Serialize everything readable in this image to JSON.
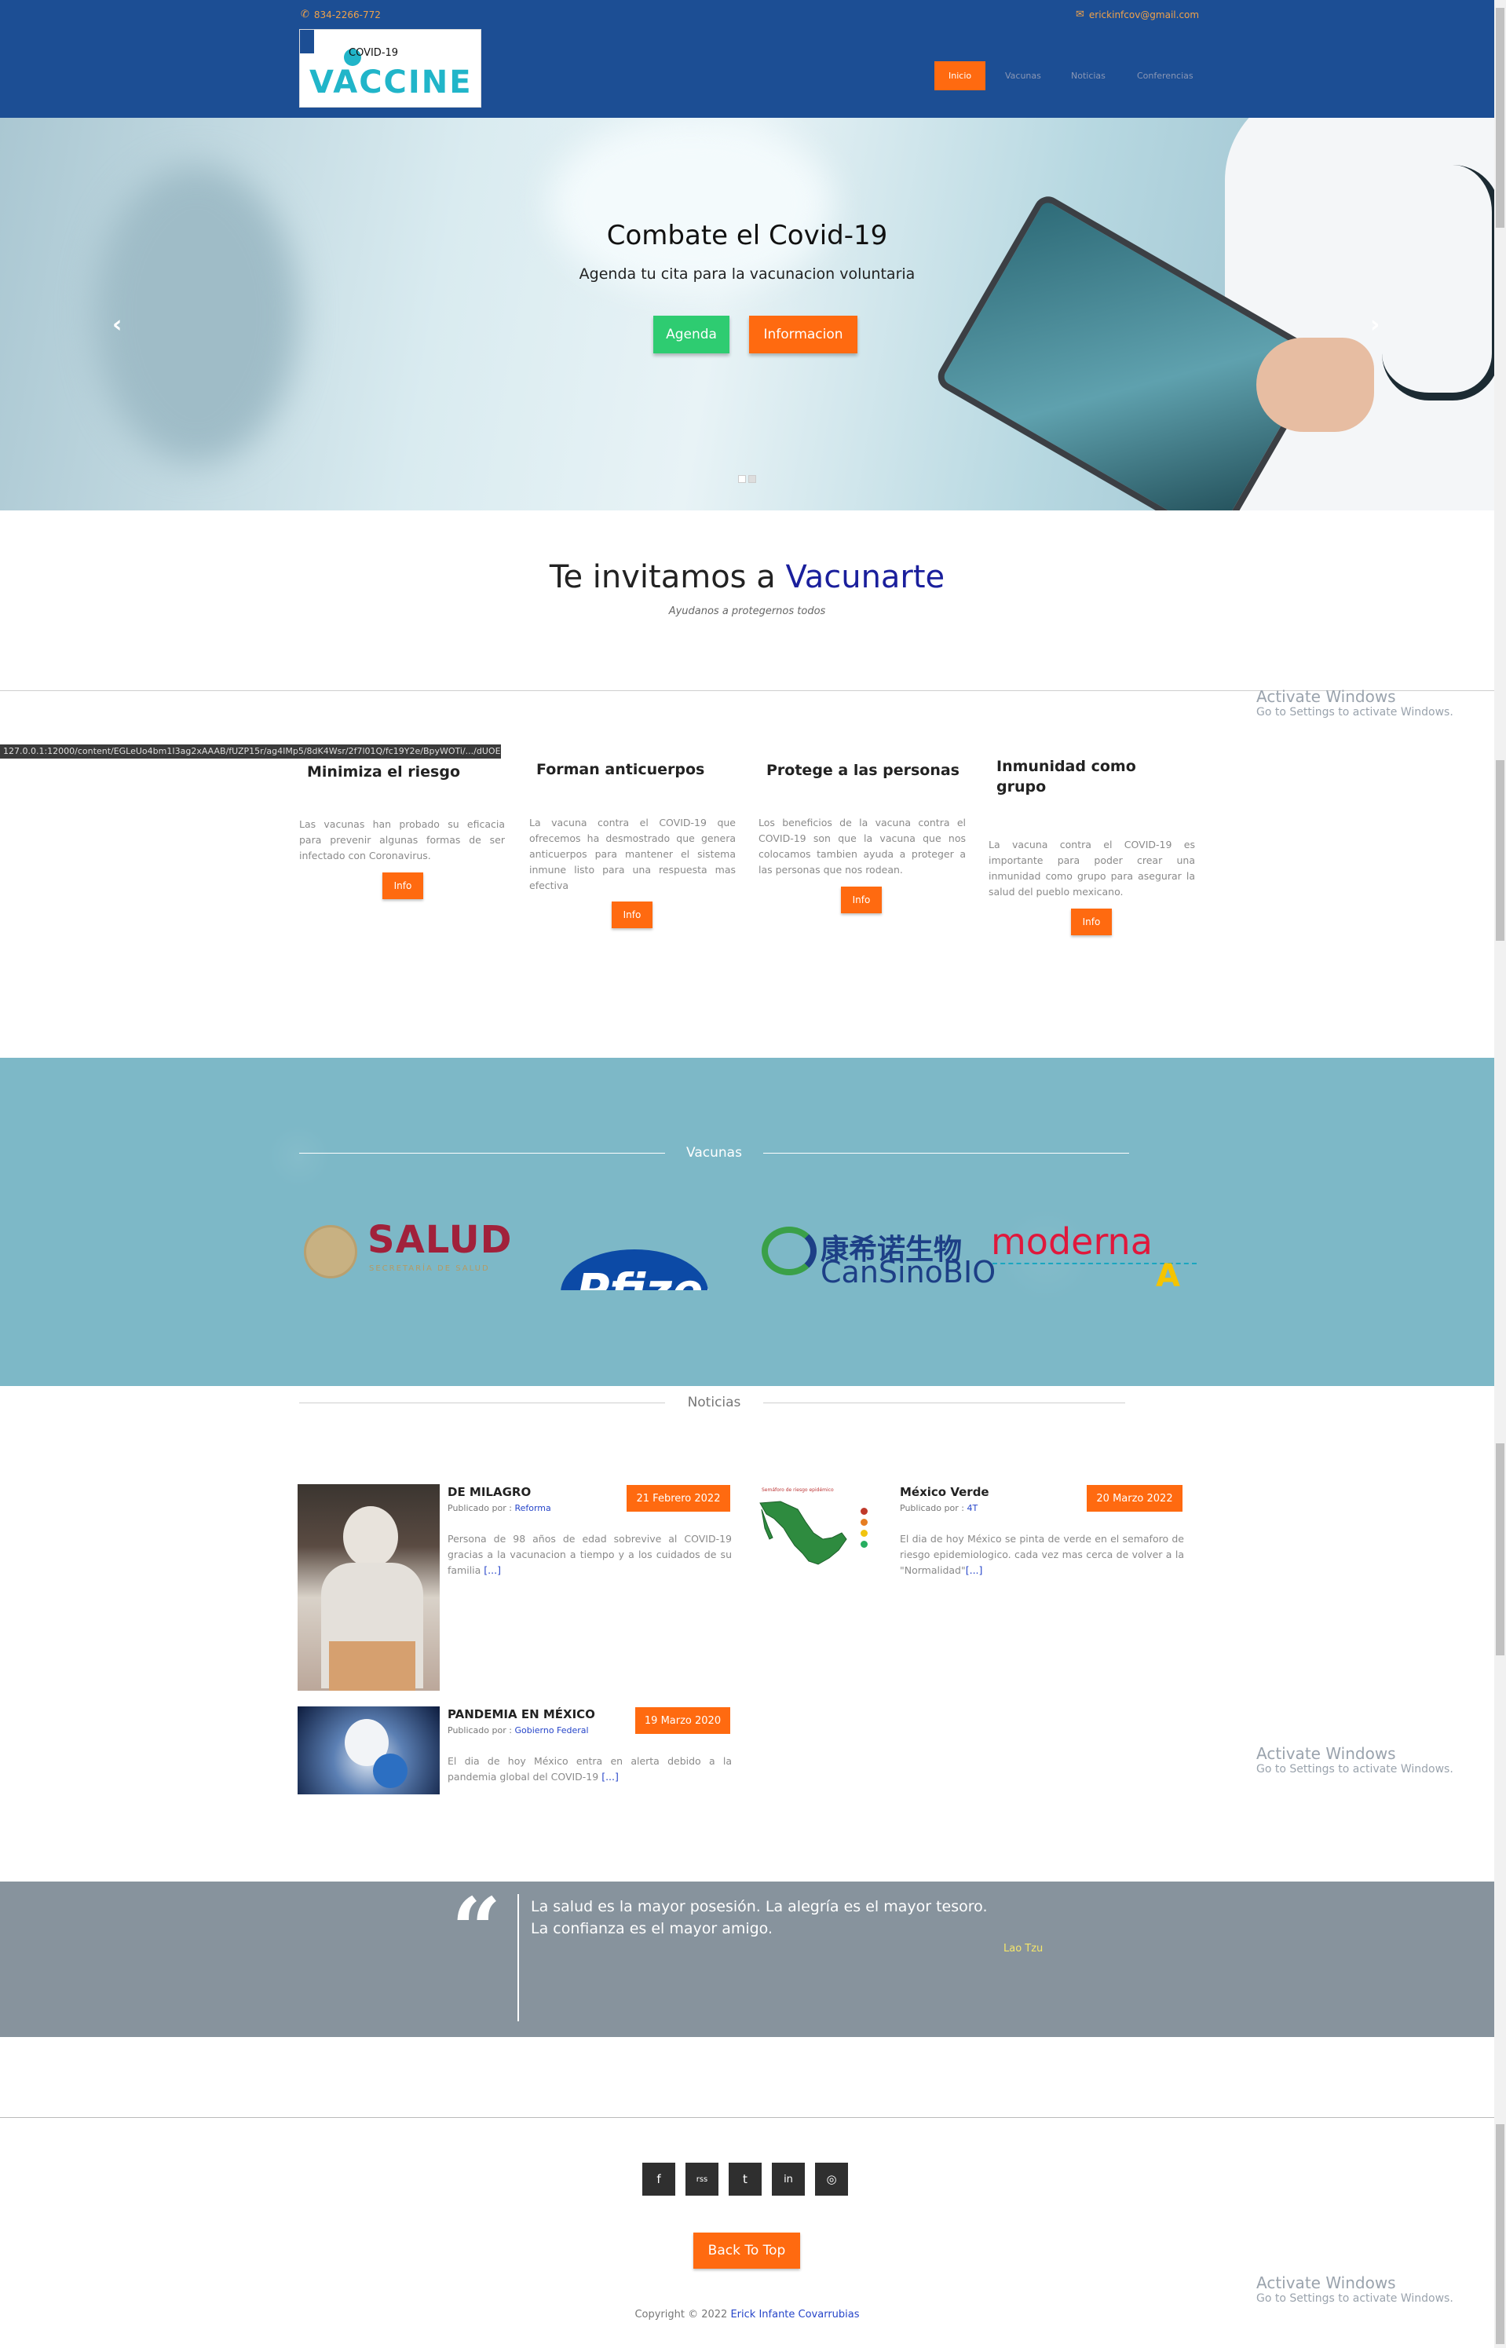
{
  "header": {
    "phone": "834-2266-772",
    "email": "erickinfcov@gmail.com",
    "logo_top": "COVID-19",
    "logo_main": "VACCINE",
    "nav": [
      "Inicio",
      "Vacunas",
      "Noticias",
      "Conferencias"
    ]
  },
  "hero": {
    "title": "Combate el Covid-19",
    "subtitle": "Agenda tu cita para la vacunacion voluntaria",
    "btn_agenda": "Agenda",
    "btn_info": "Informacion",
    "prev_icon": "‹",
    "next_icon": "›"
  },
  "invite": {
    "title_prefix": "Te invitamos a ",
    "title_highlight": "Vacunarte",
    "subtitle": "Ayudanos a protegernos todos"
  },
  "status_tooltip": "127.0.0.1:12000/content/EGLeUo4bm1I3ag2xAAAB/fUZP15r/ag4IMp5/8dK4Wsr/2f7l01Q/fc19Y2e/BpyWOTi/.../dUOE...",
  "features": [
    {
      "title": "Minimiza el riesgo",
      "text": "Las vacunas han probado su eficacia para prevenir algunas formas de ser infectado con Coronavirus.",
      "button": "Info"
    },
    {
      "title": "Forman anticuerpos",
      "text": "La vacuna contra el COVID-19 que ofrecemos ha desmostrado que genera anticuerpos para mantener el sistema inmune listo para una respuesta mas efectiva",
      "button": "Info"
    },
    {
      "title": "Protege a las personas",
      "text": "Los beneficios de la vacuna contra el COVID-19 son que la vacuna que nos colocamos tambien ayuda a proteger a las personas que nos rodean.",
      "button": "Info"
    },
    {
      "title": "Inmunidad como grupo",
      "text": "La vacuna contra el COVID-19 es importante para poder crear una inmunidad como grupo para asegurar la salud del pueblo mexicano.",
      "button": "Info"
    }
  ],
  "vacunas": {
    "label": "Vacunas",
    "salud": "SALUD",
    "salud_sub": "SECRETARÍA DE SALUD",
    "pfizer": "Pfizer",
    "cansino_cn": "康希诺生物",
    "cansino_en": "CanSinoBIO",
    "moderna": "moderna",
    "moderna_mark": "A"
  },
  "noticias": {
    "label": "Noticias",
    "published_by": "Publicado por : ",
    "more": "[...]",
    "items": [
      {
        "title": "DE MILAGRO",
        "date": "21 Febrero 2022",
        "author": "Reforma",
        "text": "Persona de 98 años de edad sobrevive al COVID-19 gracias a la vacunacion a tiempo y a los cuidados de su familia "
      },
      {
        "title": "México Verde",
        "date": "20 Marzo 2022",
        "author": "4T",
        "text": "El dia de hoy México se pinta de verde en el semaforo de riesgo epidemiologico. cada vez mas cerca de volver a la \"Normalidad\""
      },
      {
        "title": "PANDEMIA EN MÉXICO",
        "date": "19 Marzo 2020",
        "author": "Gobierno Federal",
        "text": "El dia de hoy México entra en alerta debido a la pandemia global del COVID-19 "
      }
    ],
    "map_title": "Semáforo de riesgo epidémico"
  },
  "quote": {
    "text": "La salud es la mayor posesión. La alegría es el mayor tesoro. La confianza es el mayor amigo.",
    "author": "Lao Tzu",
    "mark": "“"
  },
  "footer": {
    "social_icons": [
      "f",
      "rss",
      "t",
      "in",
      "◎"
    ],
    "back_to_top": "Back To Top",
    "copyright_prefix": "Copyright © 2022 ",
    "copyright_name": "Erick Infante Covarrubias"
  },
  "watermark": {
    "title": "Activate Windows",
    "subtitle": "Go to Settings to activate Windows."
  },
  "colors": {
    "header_bg": "#1c4e94",
    "accent": "#ff6a10",
    "agenda_green": "#2ecc71",
    "vacunas_bg": "#7db8c7",
    "quote_bg": "#87939d"
  }
}
